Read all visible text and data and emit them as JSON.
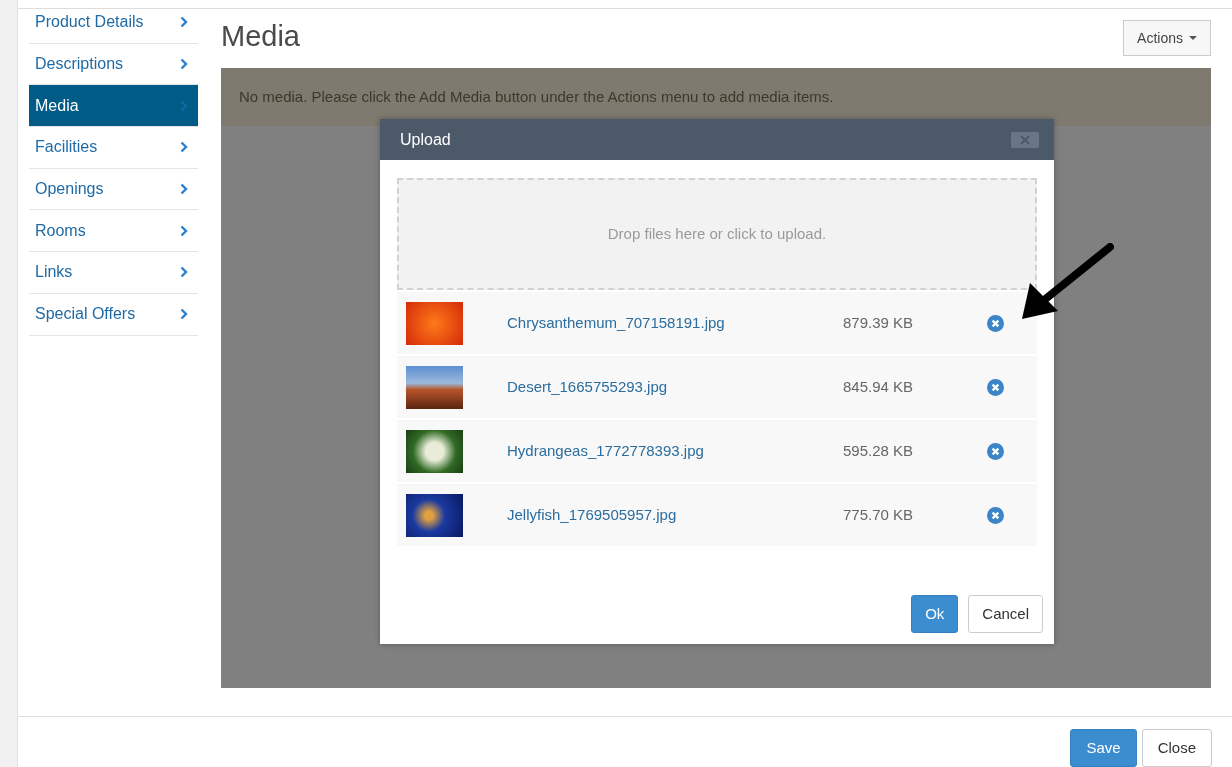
{
  "sidebar": {
    "items": [
      {
        "label": "Product Details",
        "selected": false
      },
      {
        "label": "Descriptions",
        "selected": false
      },
      {
        "label": "Media",
        "selected": true
      },
      {
        "label": "Facilities",
        "selected": false
      },
      {
        "label": "Openings",
        "selected": false
      },
      {
        "label": "Rooms",
        "selected": false
      },
      {
        "label": "Links",
        "selected": false
      },
      {
        "label": "Special Offers",
        "selected": false
      }
    ]
  },
  "page": {
    "title": "Media",
    "actions_button": "Actions",
    "alert": "No media. Please click the Add Media button under the Actions menu to add media items."
  },
  "upload_dialog": {
    "title": "Upload",
    "dropzone": "Drop files here or click to upload.",
    "files": [
      {
        "name": "Chrysanthemum_707158191.jpg",
        "size": "879.39 KB"
      },
      {
        "name": "Desert_1665755293.jpg",
        "size": "845.94 KB"
      },
      {
        "name": "Hydrangeas_1772778393.jpg",
        "size": "595.28 KB"
      },
      {
        "name": "Jellyfish_1769505957.jpg",
        "size": "775.70 KB"
      }
    ],
    "buttons": [
      {
        "label": "Ok",
        "primary": true
      },
      {
        "label": "Cancel",
        "primary": false
      }
    ]
  },
  "footer": {
    "buttons": [
      {
        "label": "Save",
        "primary": true
      },
      {
        "label": "Close",
        "primary": false
      }
    ]
  }
}
